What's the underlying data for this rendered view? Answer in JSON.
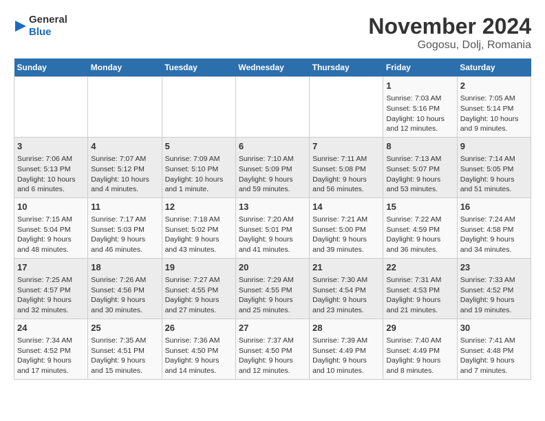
{
  "logo": {
    "text_general": "General",
    "text_blue": "Blue"
  },
  "title": "November 2024",
  "location": "Gogosu, Dolj, Romania",
  "days_of_week": [
    "Sunday",
    "Monday",
    "Tuesday",
    "Wednesday",
    "Thursday",
    "Friday",
    "Saturday"
  ],
  "weeks": [
    [
      {
        "day": "",
        "info": ""
      },
      {
        "day": "",
        "info": ""
      },
      {
        "day": "",
        "info": ""
      },
      {
        "day": "",
        "info": ""
      },
      {
        "day": "",
        "info": ""
      },
      {
        "day": "1",
        "info": "Sunrise: 7:03 AM\nSunset: 5:16 PM\nDaylight: 10 hours and 12 minutes."
      },
      {
        "day": "2",
        "info": "Sunrise: 7:05 AM\nSunset: 5:14 PM\nDaylight: 10 hours and 9 minutes."
      }
    ],
    [
      {
        "day": "3",
        "info": "Sunrise: 7:06 AM\nSunset: 5:13 PM\nDaylight: 10 hours and 6 minutes."
      },
      {
        "day": "4",
        "info": "Sunrise: 7:07 AM\nSunset: 5:12 PM\nDaylight: 10 hours and 4 minutes."
      },
      {
        "day": "5",
        "info": "Sunrise: 7:09 AM\nSunset: 5:10 PM\nDaylight: 10 hours and 1 minute."
      },
      {
        "day": "6",
        "info": "Sunrise: 7:10 AM\nSunset: 5:09 PM\nDaylight: 9 hours and 59 minutes."
      },
      {
        "day": "7",
        "info": "Sunrise: 7:11 AM\nSunset: 5:08 PM\nDaylight: 9 hours and 56 minutes."
      },
      {
        "day": "8",
        "info": "Sunrise: 7:13 AM\nSunset: 5:07 PM\nDaylight: 9 hours and 53 minutes."
      },
      {
        "day": "9",
        "info": "Sunrise: 7:14 AM\nSunset: 5:05 PM\nDaylight: 9 hours and 51 minutes."
      }
    ],
    [
      {
        "day": "10",
        "info": "Sunrise: 7:15 AM\nSunset: 5:04 PM\nDaylight: 9 hours and 48 minutes."
      },
      {
        "day": "11",
        "info": "Sunrise: 7:17 AM\nSunset: 5:03 PM\nDaylight: 9 hours and 46 minutes."
      },
      {
        "day": "12",
        "info": "Sunrise: 7:18 AM\nSunset: 5:02 PM\nDaylight: 9 hours and 43 minutes."
      },
      {
        "day": "13",
        "info": "Sunrise: 7:20 AM\nSunset: 5:01 PM\nDaylight: 9 hours and 41 minutes."
      },
      {
        "day": "14",
        "info": "Sunrise: 7:21 AM\nSunset: 5:00 PM\nDaylight: 9 hours and 39 minutes."
      },
      {
        "day": "15",
        "info": "Sunrise: 7:22 AM\nSunset: 4:59 PM\nDaylight: 9 hours and 36 minutes."
      },
      {
        "day": "16",
        "info": "Sunrise: 7:24 AM\nSunset: 4:58 PM\nDaylight: 9 hours and 34 minutes."
      }
    ],
    [
      {
        "day": "17",
        "info": "Sunrise: 7:25 AM\nSunset: 4:57 PM\nDaylight: 9 hours and 32 minutes."
      },
      {
        "day": "18",
        "info": "Sunrise: 7:26 AM\nSunset: 4:56 PM\nDaylight: 9 hours and 30 minutes."
      },
      {
        "day": "19",
        "info": "Sunrise: 7:27 AM\nSunset: 4:55 PM\nDaylight: 9 hours and 27 minutes."
      },
      {
        "day": "20",
        "info": "Sunrise: 7:29 AM\nSunset: 4:55 PM\nDaylight: 9 hours and 25 minutes."
      },
      {
        "day": "21",
        "info": "Sunrise: 7:30 AM\nSunset: 4:54 PM\nDaylight: 9 hours and 23 minutes."
      },
      {
        "day": "22",
        "info": "Sunrise: 7:31 AM\nSunset: 4:53 PM\nDaylight: 9 hours and 21 minutes."
      },
      {
        "day": "23",
        "info": "Sunrise: 7:33 AM\nSunset: 4:52 PM\nDaylight: 9 hours and 19 minutes."
      }
    ],
    [
      {
        "day": "24",
        "info": "Sunrise: 7:34 AM\nSunset: 4:52 PM\nDaylight: 9 hours and 17 minutes."
      },
      {
        "day": "25",
        "info": "Sunrise: 7:35 AM\nSunset: 4:51 PM\nDaylight: 9 hours and 15 minutes."
      },
      {
        "day": "26",
        "info": "Sunrise: 7:36 AM\nSunset: 4:50 PM\nDaylight: 9 hours and 14 minutes."
      },
      {
        "day": "27",
        "info": "Sunrise: 7:37 AM\nSunset: 4:50 PM\nDaylight: 9 hours and 12 minutes."
      },
      {
        "day": "28",
        "info": "Sunrise: 7:39 AM\nSunset: 4:49 PM\nDaylight: 9 hours and 10 minutes."
      },
      {
        "day": "29",
        "info": "Sunrise: 7:40 AM\nSunset: 4:49 PM\nDaylight: 9 hours and 8 minutes."
      },
      {
        "day": "30",
        "info": "Sunrise: 7:41 AM\nSunset: 4:48 PM\nDaylight: 9 hours and 7 minutes."
      }
    ]
  ]
}
